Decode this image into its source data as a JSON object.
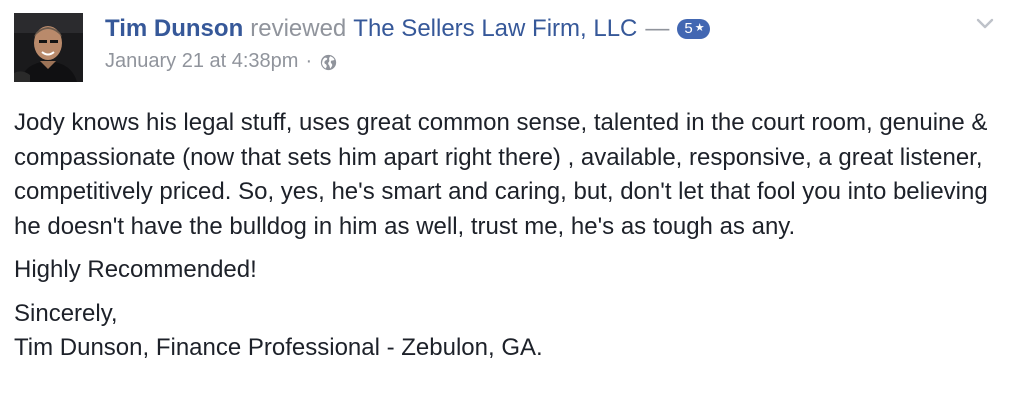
{
  "post": {
    "author": "Tim Dunson",
    "verb": "reviewed",
    "page_name": "The Sellers Law Firm, LLC",
    "dash": "—",
    "rating": "5",
    "rating_max": 5,
    "timestamp": "January 21 at 4:38pm",
    "separator": "·",
    "audience_icon": "globe-icon",
    "menu_icon": "chevron-down-icon",
    "badge_color": "#4267b2",
    "link_color": "#365899"
  },
  "review": {
    "paragraph_1": "Jody knows his legal stuff, uses great common sense, talented in the court room, genuine & compassionate (now that sets him apart right there) , available, responsive, a great listener, competitively priced. So, yes, he's smart and caring, but, don't let that fool you into believing he doesn't have the bulldog in him as well, trust me, he's as tough as any.",
    "paragraph_2": "Highly Recommended!",
    "signoff": "Sincerely,",
    "signature": "Tim Dunson, Finance Professional - Zebulon, GA."
  }
}
